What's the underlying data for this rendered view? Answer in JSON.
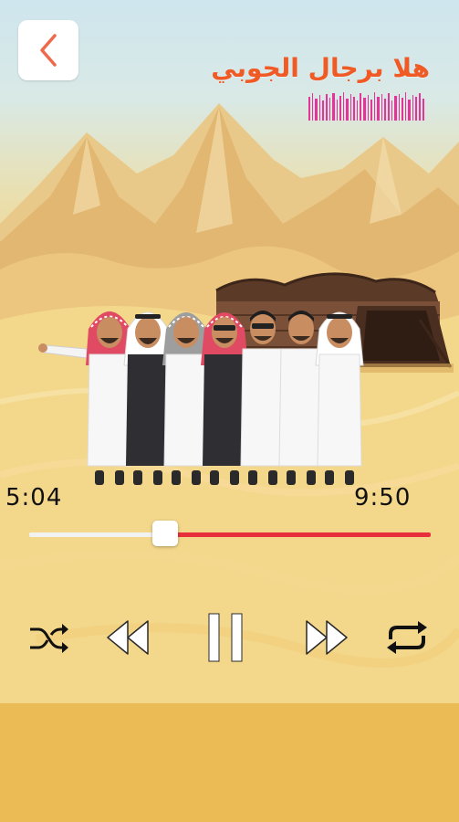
{
  "song": {
    "title": "هلا برجال الجوبي"
  },
  "player": {
    "current_time": "5:04",
    "total_time": "9:50",
    "progress": 0.338,
    "colors": {
      "played": "#f2f2f2",
      "remaining": "#e8303c",
      "title": "#f05a24",
      "thumb": "#ffffff"
    }
  },
  "icons": {
    "back": "chevron-left-icon",
    "shuffle": "shuffle-icon",
    "rewind": "rewind-icon",
    "pause": "pause-icon",
    "fast_forward": "fast-forward-icon",
    "repeat": "repeat-icon"
  }
}
